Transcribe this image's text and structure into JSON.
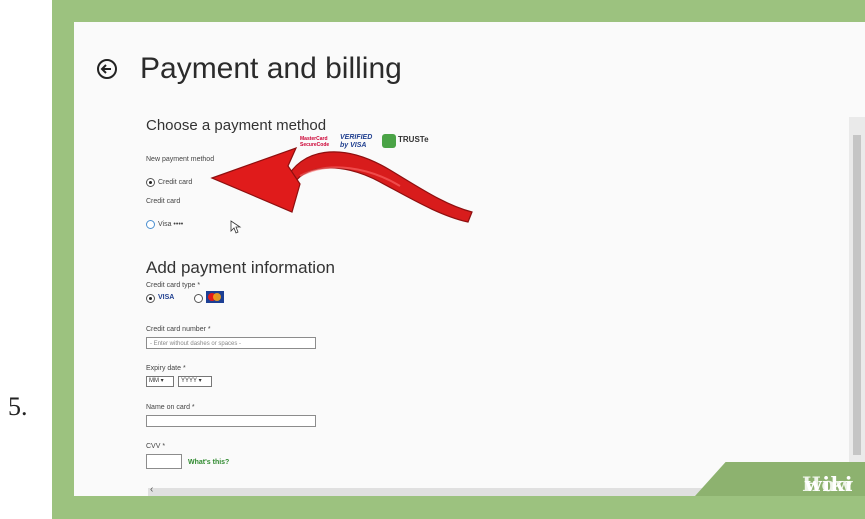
{
  "step": {
    "number": "5."
  },
  "page": {
    "title": "Payment and billing"
  },
  "payment_method": {
    "heading": "Choose a payment method",
    "logos": {
      "mastercard": "MasterCard SecureCode",
      "visa": "VERIFIED by VISA",
      "truste": "TRUSTe"
    },
    "new_method_label": "New payment method",
    "credit_card_option": "Credit card",
    "credit_card_label": "Credit card",
    "visa_option": "Visa ••••"
  },
  "payment_info": {
    "heading": "Add payment information",
    "card_type_label": "Credit card type *",
    "visa_option": "VISA",
    "card_number_label": "Credit card number *",
    "card_number_placeholder": "- Enter without dashes or spaces -",
    "expiry_label": "Expiry date *",
    "month_value": "MM",
    "year_value": "YYYY",
    "name_label": "Name on card *",
    "cvv_label": "CVV *",
    "whats_this": "What's this?"
  },
  "watermark": {
    "wiki": "wiki",
    "how": "How"
  },
  "colors": {
    "frame": "#9cc27f",
    "arrow": "#e01b1b",
    "link": "#2f8a2f"
  }
}
